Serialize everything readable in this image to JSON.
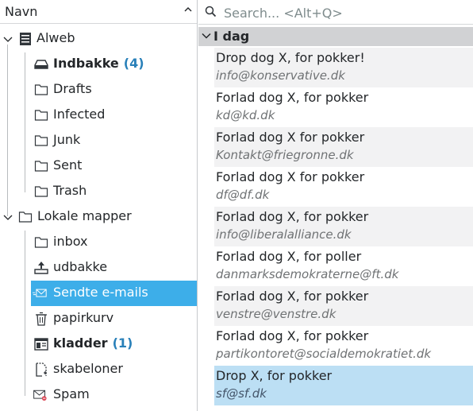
{
  "folders_pane": {
    "header_label": "Navn",
    "accounts": [
      {
        "name": "Alweb",
        "folders": [
          {
            "label": "Indbakke",
            "count": "(4)",
            "icon": "inbox-icon",
            "bold": true
          },
          {
            "label": "Drafts",
            "count": "",
            "icon": "folder-icon",
            "bold": false
          },
          {
            "label": "Infected",
            "count": "",
            "icon": "folder-icon",
            "bold": false
          },
          {
            "label": "Junk",
            "count": "",
            "icon": "folder-icon",
            "bold": false
          },
          {
            "label": "Sent",
            "count": "",
            "icon": "folder-icon",
            "bold": false
          },
          {
            "label": "Trash",
            "count": "",
            "icon": "folder-icon",
            "bold": false
          }
        ]
      },
      {
        "name": "Lokale mapper",
        "folders": [
          {
            "label": "inbox",
            "count": "",
            "icon": "folder-icon",
            "bold": false
          },
          {
            "label": "udbakke",
            "count": "",
            "icon": "outbox-icon",
            "bold": false
          },
          {
            "label": "Sendte e-mails",
            "count": "",
            "icon": "sent-mail-icon",
            "bold": false,
            "selected": true
          },
          {
            "label": "papirkurv",
            "count": "",
            "icon": "trash-can-icon",
            "bold": false
          },
          {
            "label": "kladder",
            "count": "(1)",
            "icon": "drafts-icon",
            "bold": true
          },
          {
            "label": "skabeloner",
            "count": "",
            "icon": "template-icon",
            "bold": false
          },
          {
            "label": "Spam",
            "count": "",
            "icon": "spam-icon",
            "bold": false
          }
        ]
      }
    ]
  },
  "message_list": {
    "search_placeholder": "Search... <Alt+Q>",
    "group_label": "I dag",
    "messages": [
      {
        "subject": "Drop dog X, for pokker!",
        "from": "info@konservative.dk"
      },
      {
        "subject": "Forlad dog X, for pokker",
        "from": "kd@kd.dk"
      },
      {
        "subject": "Forlad dog X for pokker",
        "from": "Kontakt@friegronne.dk"
      },
      {
        "subject": "Forlad dog X for pokker",
        "from": "df@df.dk"
      },
      {
        "subject": "Forlad dog X, for pokker",
        "from": "info@liberalalliance.dk"
      },
      {
        "subject": "Forlad dog X, for poller",
        "from": "danmarksdemokraterne@ft.dk"
      },
      {
        "subject": "Forlad dog X, for pokker",
        "from": "venstre@venstre.dk"
      },
      {
        "subject": "Forlad dog X, for pokker",
        "from": "partikontoret@socialdemokratiet.dk"
      },
      {
        "subject": "Drop X, for pokker",
        "from": "sf@sf.dk"
      }
    ]
  },
  "colors": {
    "selection": "#3daee9",
    "unread_count": "#2980b9",
    "selected_message": "#bcdff4",
    "group_header": "#d1d2d4"
  }
}
